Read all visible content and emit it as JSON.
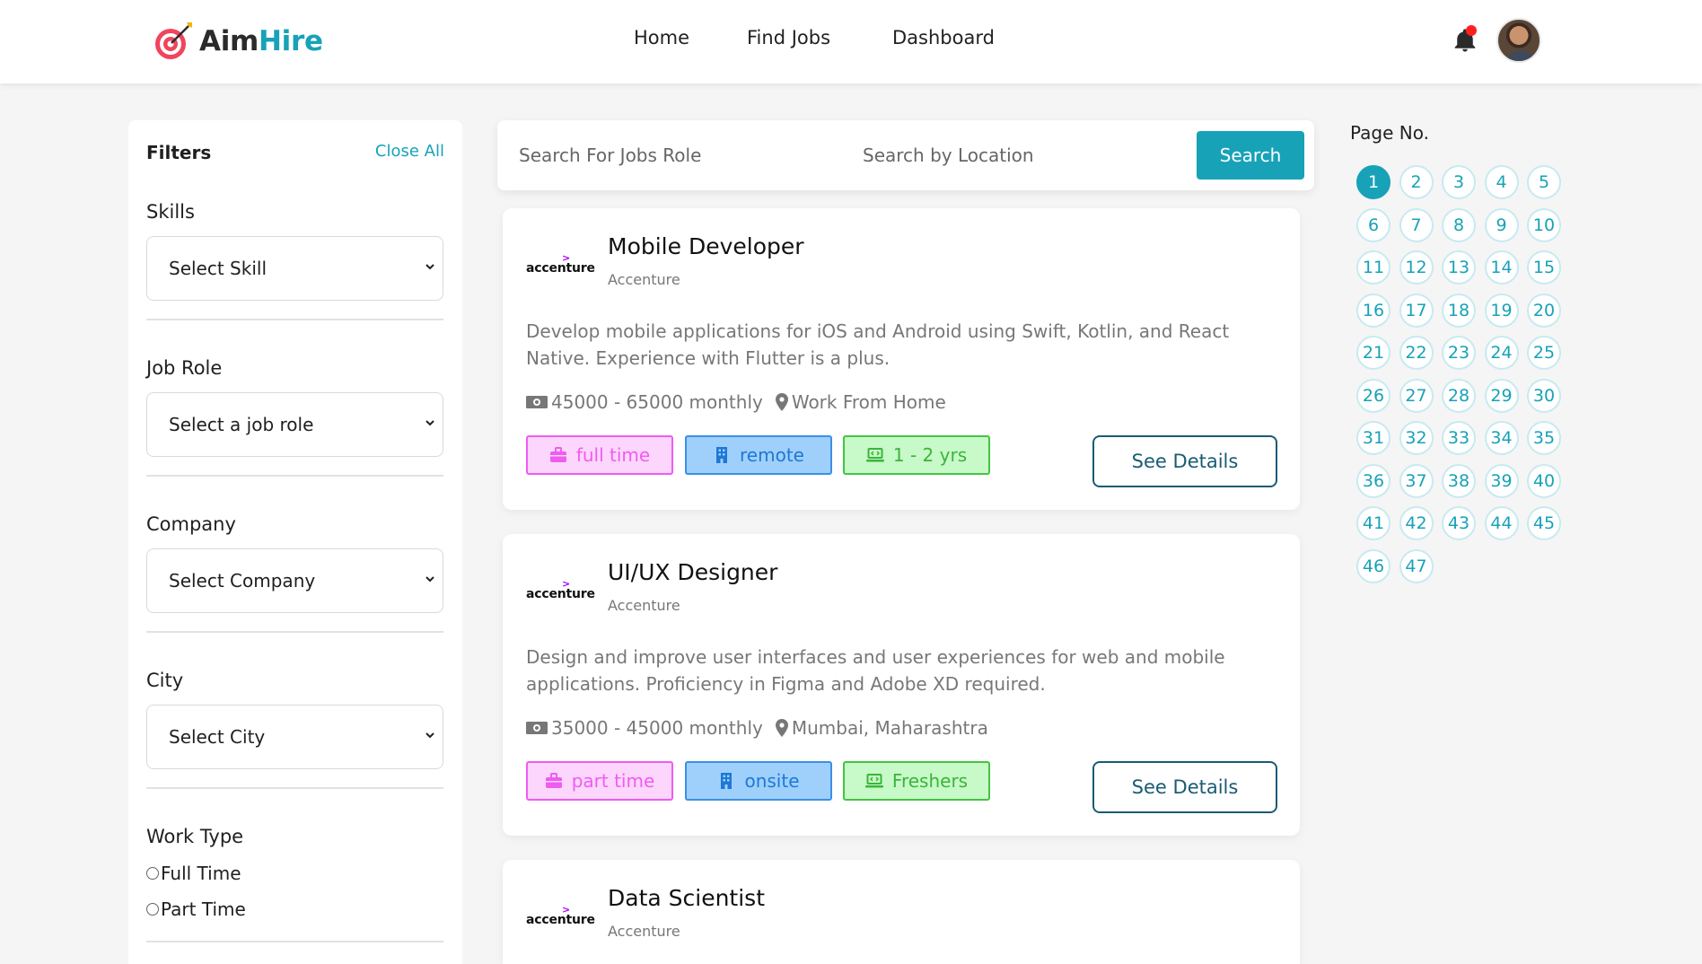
{
  "brand": {
    "aim": "Aim",
    "hire": "Hire"
  },
  "nav": {
    "home": "Home",
    "find_jobs": "Find Jobs",
    "dashboard": "Dashboard"
  },
  "filters": {
    "title": "Filters",
    "close_all": "Close All",
    "skills_label": "Skills",
    "skills_value": "Select Skill",
    "job_role_label": "Job Role",
    "job_role_value": "Select a job role",
    "company_label": "Company",
    "company_value": "Select Company",
    "city_label": "City",
    "city_value": "Select City",
    "work_type_label": "Work Type",
    "work_type_options": [
      "Full Time",
      "Part Time"
    ]
  },
  "search": {
    "role_placeholder": "Search For Jobs Role",
    "location_placeholder": "Search by Location",
    "button": "Search"
  },
  "jobs": [
    {
      "logo_text": "accenture",
      "title": "Mobile Developer",
      "company": "Accenture",
      "description": "Develop mobile applications for iOS and Android using Swift, Kotlin, and React Native. Experience with Flutter is a plus.",
      "salary": "45000 - 65000 monthly",
      "location": "Work From Home",
      "tags": [
        "full time",
        "remote",
        "1 - 2 yrs"
      ],
      "button": "See Details"
    },
    {
      "logo_text": "accenture",
      "title": "UI/UX Designer",
      "company": "Accenture",
      "description": "Design and improve user interfaces and user experiences for web and mobile applications. Proficiency in Figma and Adobe XD required.",
      "salary": "35000 - 45000 monthly",
      "location": "Mumbai, Maharashtra",
      "tags": [
        "part time",
        "onsite",
        "Freshers"
      ],
      "button": "See Details"
    },
    {
      "logo_text": "accenture",
      "title": "Data Scientist",
      "company": "Accenture"
    }
  ],
  "pagination": {
    "title": "Page No.",
    "current": 1,
    "pages": [
      "1",
      "2",
      "3",
      "4",
      "5",
      "6",
      "7",
      "8",
      "9",
      "10",
      "11",
      "12",
      "13",
      "14",
      "15",
      "16",
      "17",
      "18",
      "19",
      "20",
      "21",
      "22",
      "23",
      "24",
      "25",
      "26",
      "27",
      "28",
      "29",
      "30",
      "31",
      "32",
      "33",
      "34",
      "35",
      "36",
      "37",
      "38",
      "39",
      "40",
      "41",
      "42",
      "43",
      "44",
      "45",
      "46",
      "47"
    ]
  },
  "colors": {
    "accent": "#17a2b8",
    "notification_dot": "#ff1f1f",
    "tag_pink": "#ef5cf0",
    "tag_blue": "#1e78d4",
    "tag_green": "#3ab53a"
  },
  "icons": {
    "brand_logo": "target-arrow-icon",
    "notification": "bell-icon",
    "salary": "money-icon",
    "location": "map-pin-icon",
    "job_type": "briefcase-icon",
    "work_mode": "building-icon",
    "experience": "laptop-code-icon"
  }
}
